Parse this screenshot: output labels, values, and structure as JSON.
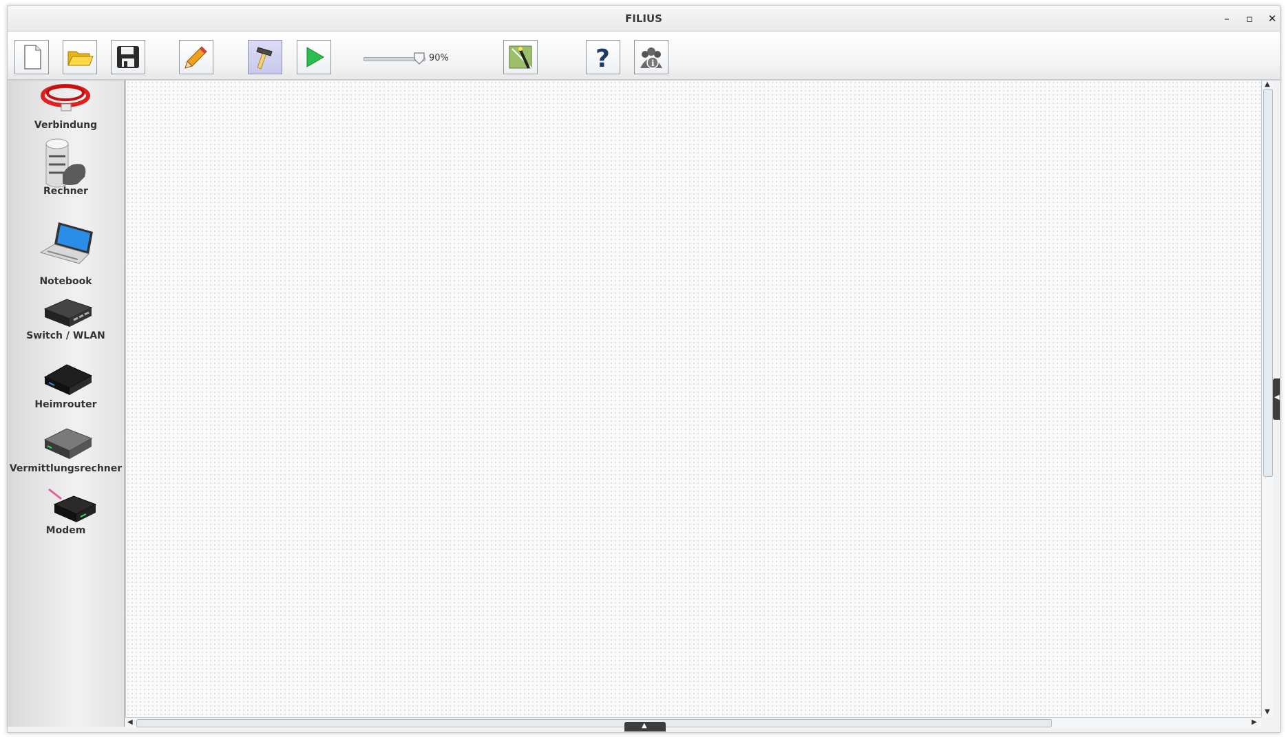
{
  "window": {
    "title": "FILIUS"
  },
  "titlebar": {
    "minimize": "–",
    "maximize": "▫",
    "close": "✕"
  },
  "toolbar": {
    "zoom": {
      "value_percent": 90,
      "label": "90%"
    },
    "buttons": [
      "new-icon",
      "open-folder-icon",
      "save-icon",
      "pencil-icon",
      "hammer-icon",
      "play-icon",
      "wizard-icon",
      "help-icon",
      "info-icon"
    ],
    "active_mode": "hammer"
  },
  "palette": {
    "items": [
      {
        "label": "Verbindung",
        "icon": "cable-icon"
      },
      {
        "label": "Rechner",
        "icon": "server-icon"
      },
      {
        "label": "Notebook",
        "icon": "laptop-icon"
      },
      {
        "label": "Switch / WLAN",
        "icon": "switch-icon"
      },
      {
        "label": "Heimrouter",
        "icon": "home-router-icon"
      },
      {
        "label": "Vermittlungsrechner",
        "icon": "router-icon"
      },
      {
        "label": "Modem",
        "icon": "modem-icon"
      }
    ]
  },
  "colors": {
    "active_button": "#c8c8ec",
    "cable": "#e02020",
    "play": "#2bbd4f"
  }
}
